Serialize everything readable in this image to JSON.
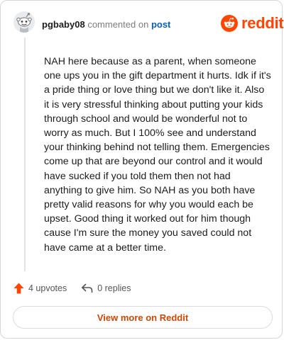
{
  "comment": {
    "username": "pgbaby08",
    "action_text": "commented on",
    "post_link": "post",
    "body": "NAH here because as a parent, when someone one ups you in the gift department it hurts. Idk if it's a pride thing or love thing but we don't like it. Also it is very stressful thinking about putting your kids through school and would be wonderful not to worry as much. But I 100% see and understand your thinking behind not telling them. Emergencies come up that are beyond our control and it would have sucked if you told them then not had anything to give him. So NAH as you both have pretty valid reasons for why you would each be upset. Good thing it worked out for him though cause I'm sure the money you saved could not have came at a better time.",
    "upvotes": "4 upvotes",
    "replies": "0 replies"
  },
  "brand": {
    "name": "reddit",
    "icon": "reddit-logo-icon",
    "color": "#ff4500"
  },
  "footer": {
    "view_more": "View more on Reddit"
  },
  "icons": {
    "avatar": "snoo-avatar-icon",
    "upvote": "upvote-arrow-icon",
    "reply": "reply-arrow-icon"
  },
  "colors": {
    "accent": "#ff4500",
    "link": "#0a5fb8",
    "view_more_text": "#d14600"
  }
}
